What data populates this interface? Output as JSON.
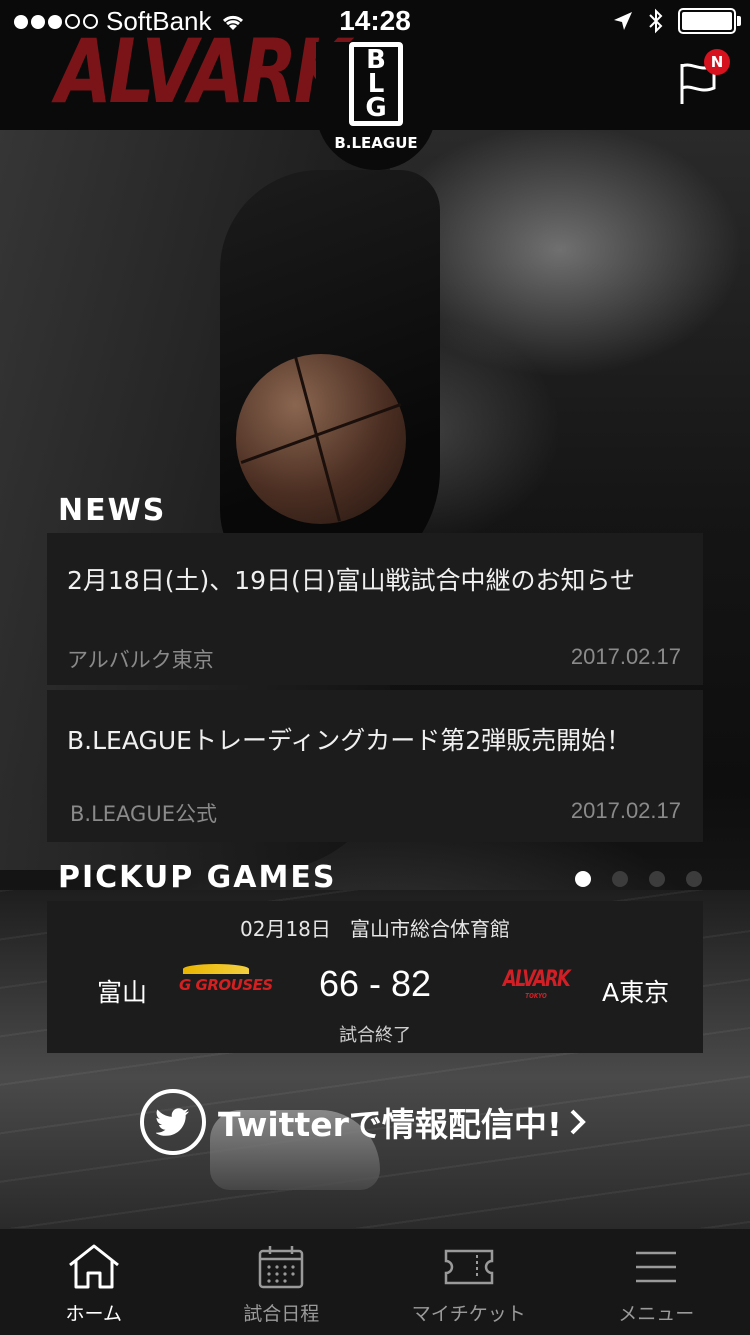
{
  "status_bar": {
    "carrier": "SoftBank",
    "time": "14:28"
  },
  "header": {
    "team_logo_text": "ALVARK",
    "league_logo_text": "B.LEAGUE",
    "notification_badge": "N"
  },
  "news": {
    "section_title": "NEWS",
    "items": [
      {
        "title": "2月18日(土)、19日(日)富山戦試合中継のお知らせ",
        "source": "アルバルク東京",
        "date": "2017.02.17"
      },
      {
        "title": "B.LEAGUEトレーディングカード第2弾販売開始！",
        "source": "B.LEAGUE公式",
        "date": "2017.02.17"
      }
    ]
  },
  "pickup": {
    "section_title": "PICKUP GAMES",
    "page_count": 4,
    "active_page": 1,
    "game": {
      "date": "02月18日",
      "venue": "富山市総合体育館",
      "home_team": "富山",
      "home_logo_text": "G GROUSES",
      "score": "66 - 82",
      "away_logo_text": "ALVARK",
      "away_logo_sub": "TOKYO",
      "away_team": "A東京",
      "status": "試合終了"
    }
  },
  "twitter": {
    "label": "Twitterで情報配信中!"
  },
  "tabs": [
    {
      "label": "ホーム",
      "icon": "home-icon",
      "active": true
    },
    {
      "label": "試合日程",
      "icon": "calendar-icon",
      "active": false
    },
    {
      "label": "マイチケット",
      "icon": "ticket-icon",
      "active": false
    },
    {
      "label": "メニュー",
      "icon": "menu-icon",
      "active": false
    }
  ]
}
